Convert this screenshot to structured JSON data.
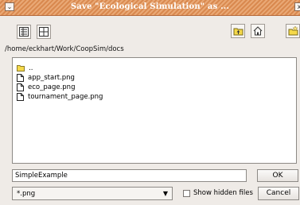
{
  "window": {
    "title": "Save \"Ecological Simulation\" as ...",
    "menu_glyph": "⌄",
    "close_glyph": "x"
  },
  "path": "/home/eckhart/Work/CoopSim/docs",
  "files": [
    {
      "name": "..",
      "icon": "folder-icon"
    },
    {
      "name": "app_start.png",
      "icon": "file-icon"
    },
    {
      "name": "eco_page.png",
      "icon": "file-icon"
    },
    {
      "name": "tournament_page.png",
      "icon": "file-icon"
    }
  ],
  "filename_value": "SimpleExample",
  "ok_label": "OK",
  "filter_value": "*.png",
  "show_hidden_label": "Show hidden files",
  "cancel_label": "Cancel",
  "colors": {
    "titlebar": "#d9894f",
    "folder": "#f5d94a"
  }
}
